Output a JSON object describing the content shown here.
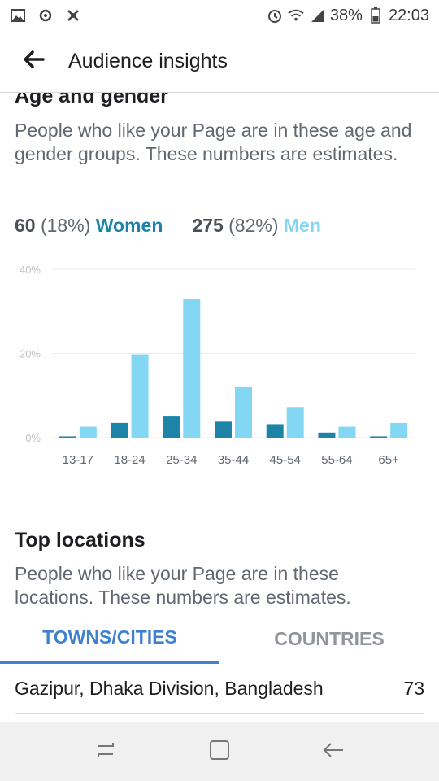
{
  "status_bar": {
    "battery": "38%",
    "time": "22:03",
    "left_icons": [
      "gallery-icon",
      "sync-icon",
      "bug-icon"
    ],
    "right_icons": [
      "alarm-icon",
      "wifi-icon",
      "signal-icon",
      "battery-icon"
    ]
  },
  "app_bar": {
    "title": "Audience insights",
    "back_icon": "arrow-left-icon"
  },
  "age_gender": {
    "title": "Age and gender",
    "description": "People who like your Page are in these age and gender groups. These numbers are estimates.",
    "women": {
      "count": "60",
      "percent": "(18%)",
      "label": "Women",
      "color": "#1d84a8"
    },
    "men": {
      "count": "275",
      "percent": "(82%)",
      "label": "Men",
      "color": "#84d7f2"
    }
  },
  "chart_data": {
    "type": "bar",
    "categories": [
      "13-17",
      "18-24",
      "25-34",
      "35-44",
      "45-54",
      "55-64",
      "65+"
    ],
    "series": [
      {
        "name": "Women",
        "values": [
          0.3,
          3.5,
          5.2,
          3.8,
          3.2,
          1.2,
          0.3
        ]
      },
      {
        "name": "Men",
        "values": [
          2.6,
          19.8,
          33.0,
          12.0,
          7.3,
          2.6,
          3.5
        ]
      }
    ],
    "ytick_labels": [
      "40%",
      "20%",
      "0%"
    ],
    "ylim": [
      0,
      40
    ],
    "grid": true
  },
  "top_locations": {
    "title": "Top locations",
    "description": "People who like your Page are in these locations. These numbers are estimates.",
    "tabs": [
      {
        "label": "TOWNS/CITIES",
        "active": true
      },
      {
        "label": "COUNTRIES",
        "active": false
      }
    ],
    "rows": [
      {
        "name": "Gazipur, Dhaka Division, Bangladesh",
        "count": "73"
      }
    ]
  },
  "nav_bar": {
    "icons": [
      "recents-icon",
      "home-icon",
      "back-icon"
    ]
  }
}
